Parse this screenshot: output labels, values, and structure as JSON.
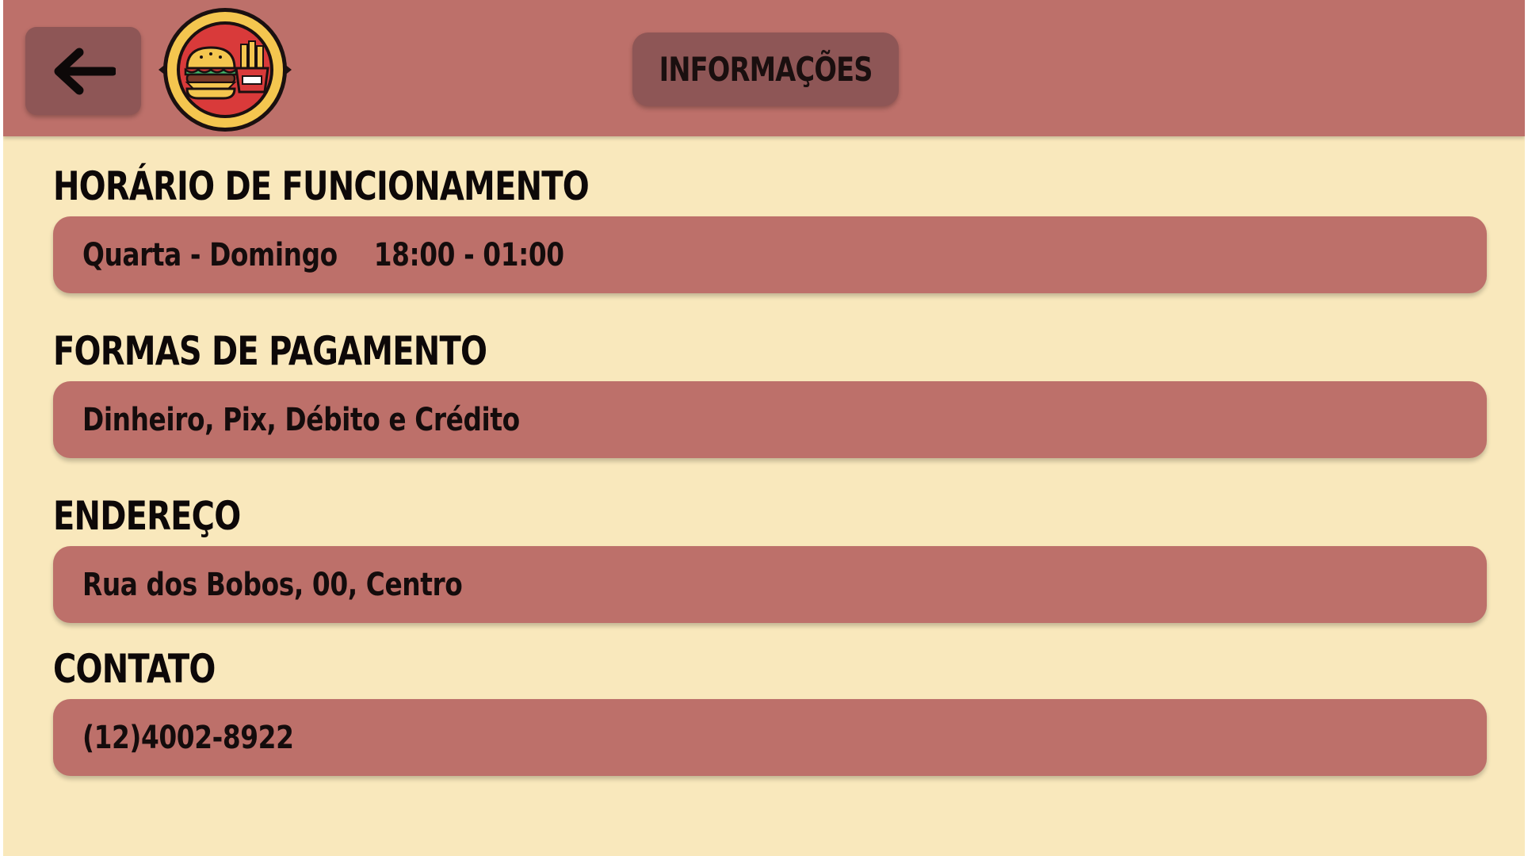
{
  "header": {
    "title": "INFORMAÇÕES",
    "back_icon": "arrow-left-icon",
    "logo_icon": "burger-fries-logo-icon"
  },
  "sections": [
    {
      "heading": "HORÁRIO DE FUNCIONAMENTO",
      "days": "Quarta - Domingo",
      "hours": "18:00 - 01:00"
    },
    {
      "heading": "FORMAS DE PAGAMENTO",
      "value": "Dinheiro, Pix, Débito e Crédito"
    },
    {
      "heading": "ENDEREÇO",
      "value": "Rua dos Bobos, 00, Centro"
    },
    {
      "heading": "CONTATO",
      "value": "(12)4002-8922"
    }
  ],
  "colors": {
    "background": "#f9e8bc",
    "header": "#bd706a",
    "button": "#8e5656",
    "bar": "#bd706a",
    "text": "#140c0c"
  }
}
